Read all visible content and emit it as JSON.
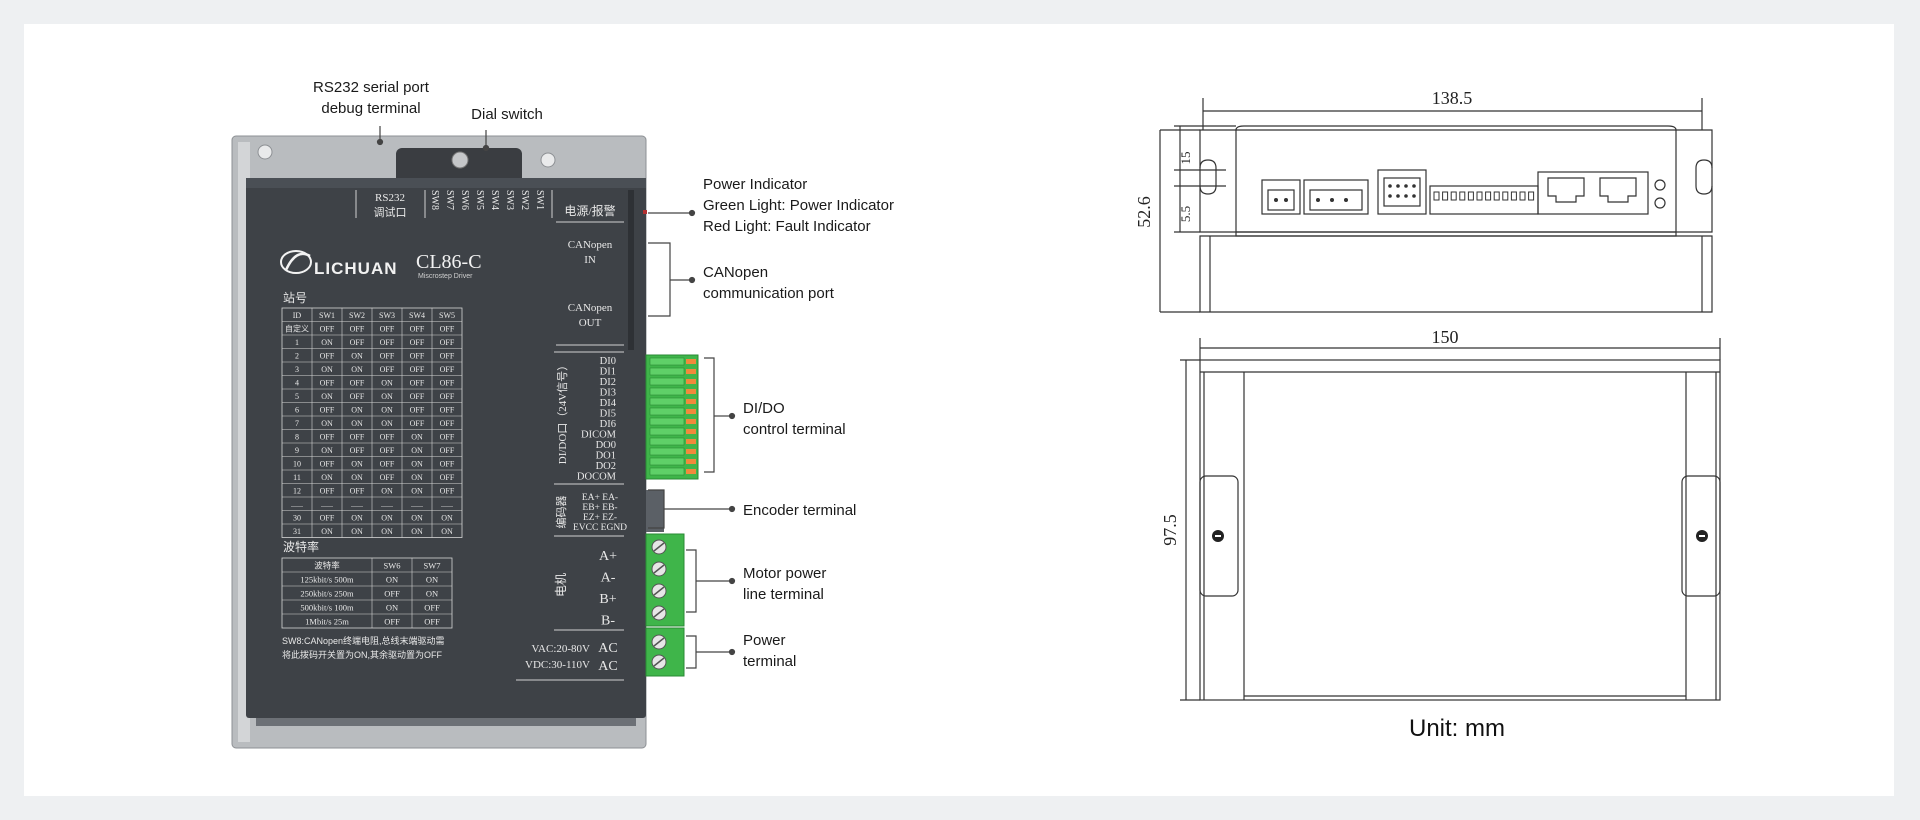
{
  "callouts": {
    "rs232_line1": "RS232 serial port",
    "rs232_line2": "debug terminal",
    "dial_switch": "Dial switch",
    "power_ind_1": "Power Indicator",
    "power_ind_2": "Green Light: Power Indicator",
    "power_ind_3": "Red Light: Fault Indicator",
    "canopen_1": "CANopen",
    "canopen_2": "communication port",
    "dido_1": "DI/DO",
    "dido_2": "control terminal",
    "encoder": "Encoder terminal",
    "motor_1": "Motor power",
    "motor_2": "line terminal",
    "power_1": "Power",
    "power_2": "terminal"
  },
  "device": {
    "brand": "LICHUAN",
    "model": "CL86-C",
    "model_sub": "Miscrostep Driver",
    "rs232_label_1": "RS232",
    "rs232_label_2": "调试口",
    "dial_labels": [
      "SW8",
      "SW7",
      "SW6",
      "SW5",
      "SW4",
      "SW3",
      "SW2",
      "SW1"
    ],
    "power_alarm": "电源/报警",
    "canopen_in_1": "CANopen",
    "canopen_in_2": "IN",
    "canopen_out_1": "CANopen",
    "canopen_out_2": "OUT",
    "station_title": "站号",
    "station_headers": [
      "ID",
      "SW1",
      "SW2",
      "SW3",
      "SW4",
      "SW5"
    ],
    "station_rows": [
      [
        "自定义",
        "OFF",
        "OFF",
        "OFF",
        "OFF",
        "OFF"
      ],
      [
        "1",
        "ON",
        "OFF",
        "OFF",
        "OFF",
        "OFF"
      ],
      [
        "2",
        "OFF",
        "ON",
        "OFF",
        "OFF",
        "OFF"
      ],
      [
        "3",
        "ON",
        "ON",
        "OFF",
        "OFF",
        "OFF"
      ],
      [
        "4",
        "OFF",
        "OFF",
        "ON",
        "OFF",
        "OFF"
      ],
      [
        "5",
        "ON",
        "OFF",
        "ON",
        "OFF",
        "OFF"
      ],
      [
        "6",
        "OFF",
        "ON",
        "ON",
        "OFF",
        "OFF"
      ],
      [
        "7",
        "ON",
        "ON",
        "ON",
        "OFF",
        "OFF"
      ],
      [
        "8",
        "OFF",
        "OFF",
        "OFF",
        "ON",
        "OFF"
      ],
      [
        "9",
        "ON",
        "OFF",
        "OFF",
        "ON",
        "OFF"
      ],
      [
        "10",
        "OFF",
        "ON",
        "OFF",
        "ON",
        "OFF"
      ],
      [
        "11",
        "ON",
        "ON",
        "OFF",
        "ON",
        "OFF"
      ],
      [
        "12",
        "OFF",
        "OFF",
        "ON",
        "ON",
        "OFF"
      ],
      [
        "......",
        "......",
        "......",
        "......",
        "......",
        "......"
      ],
      [
        "30",
        "OFF",
        "ON",
        "ON",
        "ON",
        "ON"
      ],
      [
        "31",
        "ON",
        "ON",
        "ON",
        "ON",
        "ON"
      ]
    ],
    "baud_title": "波特率",
    "baud_headers": [
      "波特率",
      "SW6",
      "SW7"
    ],
    "baud_rows": [
      [
        "125kbit/s 500m",
        "ON",
        "ON"
      ],
      [
        "250kbit/s 250m",
        "OFF",
        "ON"
      ],
      [
        "500kbit/s 100m",
        "ON",
        "OFF"
      ],
      [
        "1Mbit/s 25m",
        "OFF",
        "OFF"
      ]
    ],
    "note_1": "SW8:CANopen终端电阻,总线末端驱动需",
    "note_2": "将此拨码开关置为ON,其余驱动置为OFF",
    "dido_side_label": "DI/DO口（24V信号）",
    "dido_pins": [
      "DI0",
      "DI1",
      "DI2",
      "DI3",
      "DI4",
      "DI5",
      "DI6",
      "DICOM",
      "DO0",
      "DO1",
      "DO2",
      "DOCOM"
    ],
    "encoder_side_label": "编码器",
    "encoder_pins": [
      "EA+ EA-",
      "EB+ EB-",
      "EZ+ EZ-",
      "EVCC EGND"
    ],
    "motor_side_label": "电机",
    "motor_pins": [
      "A+",
      "A-",
      "B+",
      "B-"
    ],
    "power_vac": "VAC:20-80V",
    "power_vdc": "VDC:30-110V",
    "power_pins": [
      "AC",
      "AC"
    ]
  },
  "drawing": {
    "dim_top_width": "138.5",
    "dim_top_height": "52.6",
    "dim_15": "15",
    "dim_5_5": "5.5",
    "dim_bottom_width": "150",
    "dim_bottom_height": "97.5",
    "unit": "Unit: mm"
  },
  "colors": {
    "panel": "#3e4247",
    "terminal_green": "#3fb54a",
    "pin_orange": "#f08a3c",
    "line": "#333333"
  }
}
